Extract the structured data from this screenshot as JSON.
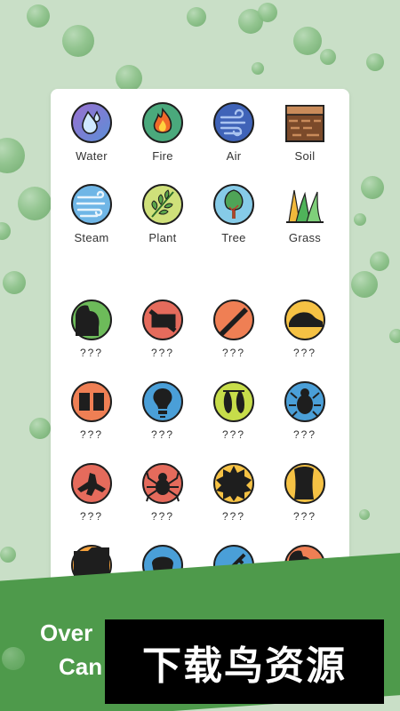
{
  "elements": {
    "discovered": [
      {
        "label": "Water",
        "icon": "water-drop-icon"
      },
      {
        "label": "Fire",
        "icon": "fire-icon"
      },
      {
        "label": "Air",
        "icon": "air-swirl-icon"
      },
      {
        "label": "Soil",
        "icon": "soil-layers-icon"
      },
      {
        "label": "Steam",
        "icon": "steam-icon"
      },
      {
        "label": "Plant",
        "icon": "leaf-branch-icon"
      },
      {
        "label": "Tree",
        "icon": "tree-icon"
      },
      {
        "label": "Grass",
        "icon": "grass-icon"
      }
    ],
    "locked": [
      {
        "label": "???",
        "icon": "locked-silhouette-icon",
        "color": "#6dbb5a"
      },
      {
        "label": "???",
        "icon": "locked-silhouette-icon",
        "color": "#e56b5c"
      },
      {
        "label": "???",
        "icon": "locked-silhouette-icon",
        "color": "#ef7f54"
      },
      {
        "label": "???",
        "icon": "locked-silhouette-icon",
        "color": "#f6c244"
      },
      {
        "label": "???",
        "icon": "locked-silhouette-icon",
        "color": "#ef7f54"
      },
      {
        "label": "???",
        "icon": "locked-bulb-icon",
        "color": "#4a9fd8"
      },
      {
        "label": "???",
        "icon": "locked-silhouette-icon",
        "color": "#c7dd4a"
      },
      {
        "label": "???",
        "icon": "locked-bug-icon",
        "color": "#4a9fd8"
      },
      {
        "label": "???",
        "icon": "locked-silhouette-icon",
        "color": "#e56b5c"
      },
      {
        "label": "???",
        "icon": "locked-spider-icon",
        "color": "#e56b5c"
      },
      {
        "label": "???",
        "icon": "locked-silhouette-icon",
        "color": "#f6c244"
      },
      {
        "label": "???",
        "icon": "locked-silhouette-icon",
        "color": "#f6c244"
      },
      {
        "label": "???",
        "icon": "locked-silhouette-icon",
        "color": "#f6a23c"
      },
      {
        "label": "???",
        "icon": "locked-silhouette-icon",
        "color": "#4a9fd8"
      },
      {
        "label": "???",
        "icon": "locked-silhouette-icon",
        "color": "#4a9fd8"
      },
      {
        "label": "???",
        "icon": "locked-silhouette-icon",
        "color": "#ef7f54"
      }
    ]
  },
  "banner": {
    "line1": "Over",
    "line2": "Can"
  },
  "watermark": {
    "text": "下载鸟资源"
  },
  "colors": {
    "background": "#c9dfc7",
    "banner": "#4e9a4b",
    "card": "#ffffff"
  }
}
